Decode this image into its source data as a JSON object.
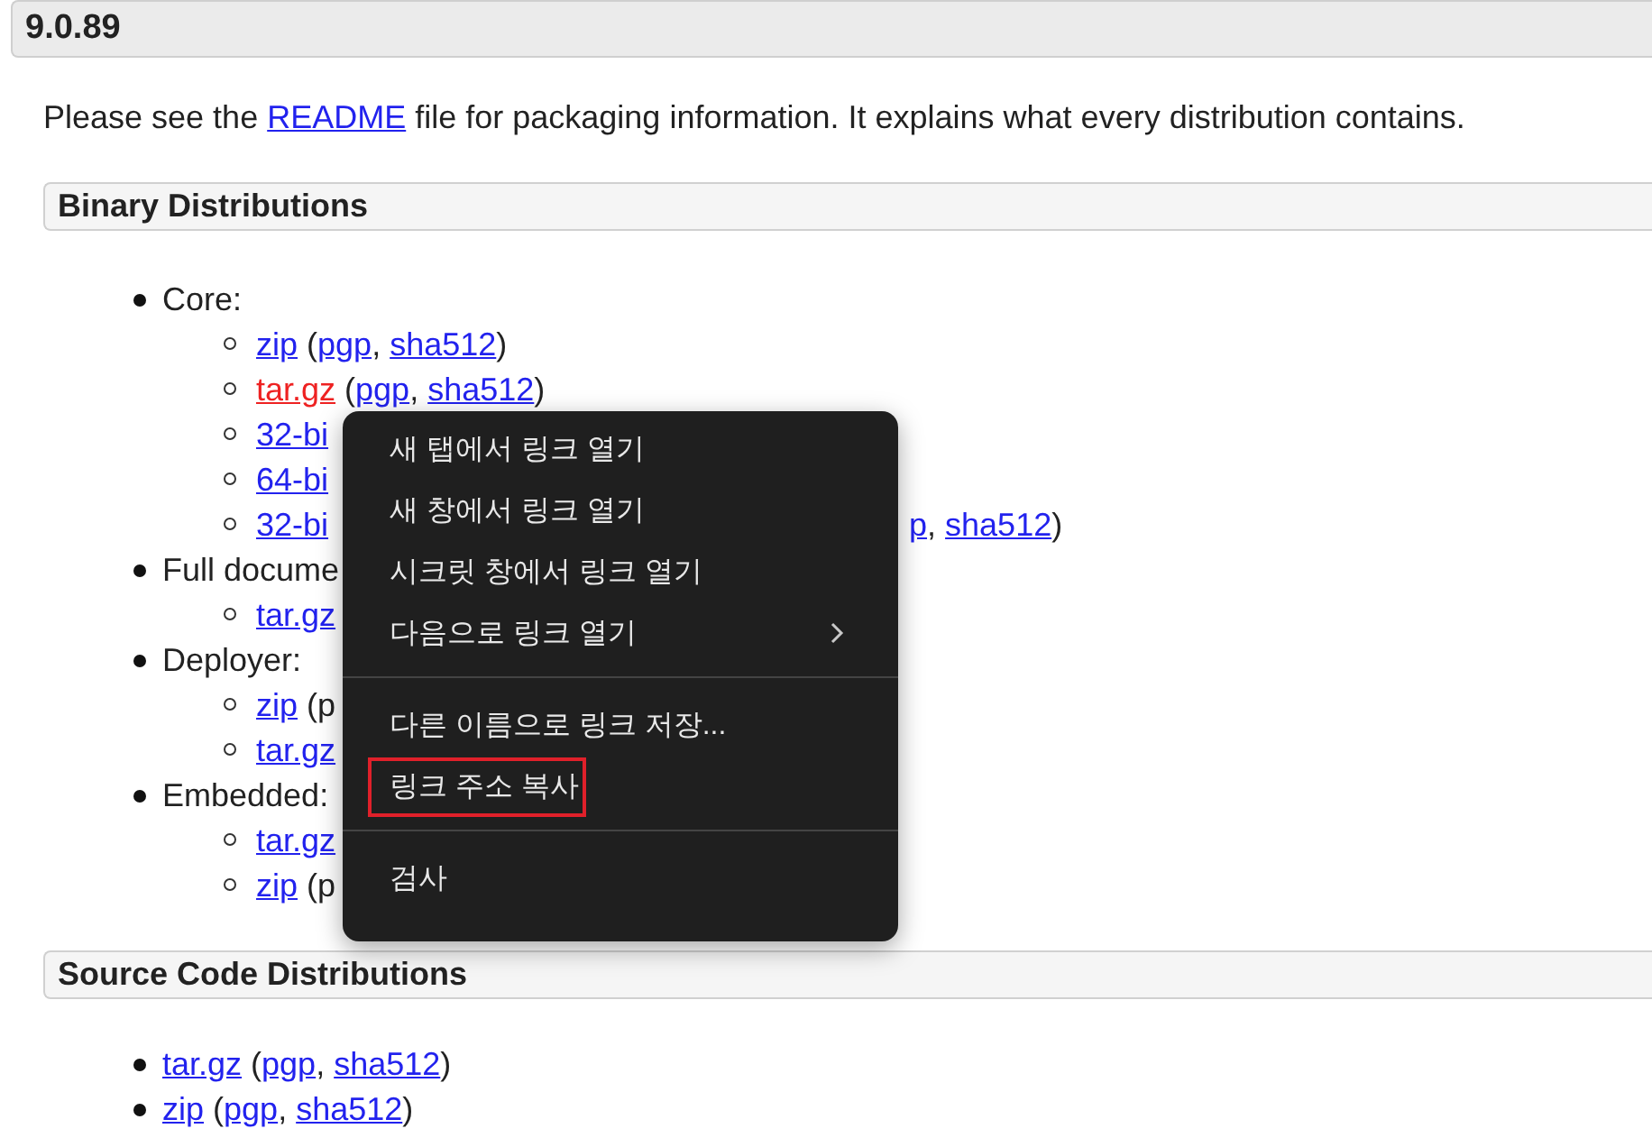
{
  "version_heading": "9.0.89",
  "intro": {
    "before": "Please see the ",
    "link": "README",
    "after": " file for packaging information. It explains what every distribution contains."
  },
  "sections": [
    {
      "heading": "Binary Distributions",
      "items": [
        {
          "label": "Core:",
          "children": [
            {
              "segments": [
                {
                  "text": "zip",
                  "kind": "link"
                },
                {
                  "text": " (",
                  "kind": "plain"
                },
                {
                  "text": "pgp",
                  "kind": "link"
                },
                {
                  "text": ", ",
                  "kind": "plain"
                },
                {
                  "text": "sha512",
                  "kind": "link"
                },
                {
                  "text": ")",
                  "kind": "plain"
                }
              ]
            },
            {
              "segments": [
                {
                  "text": "tar.gz",
                  "kind": "visited"
                },
                {
                  "text": " (",
                  "kind": "plain"
                },
                {
                  "text": "pgp",
                  "kind": "link"
                },
                {
                  "text": ", ",
                  "kind": "plain"
                },
                {
                  "text": "sha512",
                  "kind": "link"
                },
                {
                  "text": ")",
                  "kind": "plain"
                }
              ]
            },
            {
              "segments": [
                {
                  "text": "32-bi",
                  "kind": "link"
                }
              ]
            },
            {
              "segments": [
                {
                  "text": "64-bi",
                  "kind": "link"
                }
              ]
            },
            {
              "segments": [
                {
                  "text": "32-bi",
                  "kind": "link"
                }
              ],
              "tail": [
                {
                  "text": "p",
                  "kind": "link"
                },
                {
                  "text": ", ",
                  "kind": "plain"
                },
                {
                  "text": "sha512",
                  "kind": "link"
                },
                {
                  "text": ")",
                  "kind": "plain"
                }
              ]
            }
          ]
        },
        {
          "label": "Full docume",
          "children": [
            {
              "segments": [
                {
                  "text": "tar.gz",
                  "kind": "link"
                }
              ]
            }
          ]
        },
        {
          "label": "Deployer:",
          "children": [
            {
              "segments": [
                {
                  "text": "zip",
                  "kind": "link"
                },
                {
                  "text": " (p",
                  "kind": "plain"
                }
              ]
            },
            {
              "segments": [
                {
                  "text": "tar.gz",
                  "kind": "link"
                }
              ]
            }
          ]
        },
        {
          "label": "Embedded:",
          "children": [
            {
              "segments": [
                {
                  "text": "tar.gz",
                  "kind": "link"
                }
              ]
            },
            {
              "segments": [
                {
                  "text": "zip",
                  "kind": "link"
                },
                {
                  "text": " (p",
                  "kind": "plain"
                }
              ]
            }
          ]
        }
      ]
    },
    {
      "heading": "Source Code Distributions",
      "items": [
        {
          "segments": [
            {
              "text": "tar.gz",
              "kind": "link"
            },
            {
              "text": " (",
              "kind": "plain"
            },
            {
              "text": "pgp",
              "kind": "link"
            },
            {
              "text": ", ",
              "kind": "plain"
            },
            {
              "text": "sha512",
              "kind": "link"
            },
            {
              "text": ")",
              "kind": "plain"
            }
          ]
        },
        {
          "segments": [
            {
              "text": "zip",
              "kind": "link"
            },
            {
              "text": " (",
              "kind": "plain"
            },
            {
              "text": "pgp",
              "kind": "link"
            },
            {
              "text": ", ",
              "kind": "plain"
            },
            {
              "text": "sha512",
              "kind": "link"
            },
            {
              "text": ")",
              "kind": "plain"
            }
          ]
        }
      ]
    }
  ],
  "context_menu": {
    "groups": [
      [
        {
          "label": "새 탭에서 링크 열기",
          "submenu": false,
          "highlighted": false
        },
        {
          "label": "새 창에서 링크 열기",
          "submenu": false,
          "highlighted": false
        },
        {
          "label": "시크릿 창에서 링크 열기",
          "submenu": false,
          "highlighted": false
        },
        {
          "label": "다음으로 링크 열기",
          "submenu": true,
          "highlighted": false
        }
      ],
      [
        {
          "label": "다른 이름으로 링크 저장...",
          "submenu": false,
          "highlighted": false
        },
        {
          "label": "링크 주소 복사",
          "submenu": false,
          "highlighted": true
        }
      ],
      [
        {
          "label": "검사",
          "submenu": false,
          "highlighted": false
        }
      ]
    ]
  }
}
